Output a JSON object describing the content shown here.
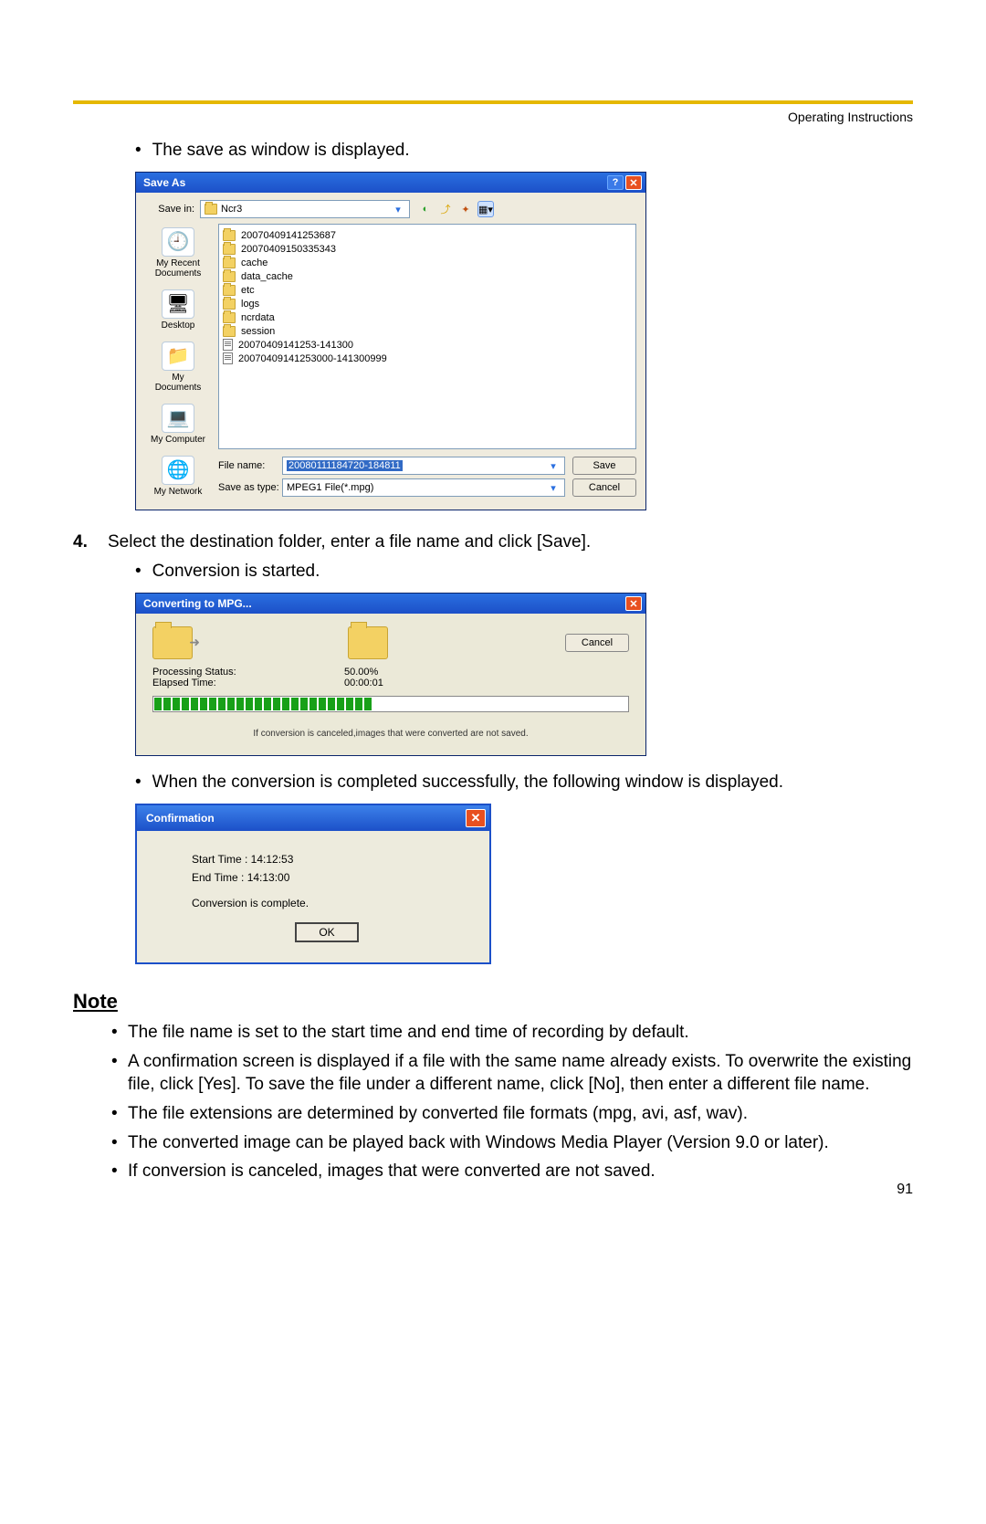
{
  "header": {
    "section": "Operating Instructions",
    "page_number": "91"
  },
  "intro_bullet": "The save as window is displayed.",
  "saveas": {
    "title": "Save As",
    "save_in_label": "Save in:",
    "save_in_folder": "Ncr3",
    "places": [
      {
        "label": "My Recent Documents",
        "glyph": "🕘"
      },
      {
        "label": "Desktop",
        "glyph": "🖥"
      },
      {
        "label": "My Documents",
        "glyph": "📁"
      },
      {
        "label": "My Computer",
        "glyph": "💻"
      },
      {
        "label": "My Network",
        "glyph": "🌐"
      }
    ],
    "items": [
      {
        "type": "folder",
        "name": "20070409141253687"
      },
      {
        "type": "folder",
        "name": "20070409150335343"
      },
      {
        "type": "folder",
        "name": "cache"
      },
      {
        "type": "folder",
        "name": "data_cache"
      },
      {
        "type": "folder",
        "name": "etc"
      },
      {
        "type": "folder",
        "name": "logs"
      },
      {
        "type": "folder",
        "name": "ncrdata"
      },
      {
        "type": "folder",
        "name": "session"
      },
      {
        "type": "file",
        "name": "20070409141253-141300"
      },
      {
        "type": "file",
        "name": "20070409141253000-141300999"
      }
    ],
    "file_name_label": "File name:",
    "file_name_value": "20080111184720-184811",
    "save_as_type_label": "Save as type:",
    "save_as_type_value": "MPEG1 File(*.mpg)",
    "save_button": "Save",
    "cancel_button": "Cancel"
  },
  "step4": {
    "number": "4.",
    "text": "Select the destination folder, enter a file name and click [Save].",
    "sub_bullet": "Conversion is started."
  },
  "converting": {
    "title": "Converting to MPG...",
    "proc_label": "Processing Status:",
    "proc_value": "50.00%",
    "elapsed_label": "Elapsed Time:",
    "elapsed_value": "00:00:01",
    "cancel": "Cancel",
    "footer": "If conversion is canceled,images that were converted are not saved."
  },
  "after_convert_bullet": "When the conversion is completed successfully, the following window is displayed.",
  "confirmation": {
    "title": "Confirmation",
    "start": "Start Time : 14:12:53",
    "end": "End Time : 14:13:00",
    "msg": "Conversion is complete.",
    "ok": "OK"
  },
  "note": {
    "heading": "Note",
    "items": [
      "The file name is set to the start time and end time of recording by default.",
      "A confirmation screen is displayed if a file with the same name already exists. To overwrite the existing file, click [Yes]. To save the file under a different name, click [No], then enter a different file name.",
      "The file extensions are determined by converted file formats (mpg, avi, asf, wav).",
      "The converted image can be played back with Windows Media Player (Version 9.0 or later).",
      "If conversion is canceled, images that were converted are not saved."
    ]
  }
}
